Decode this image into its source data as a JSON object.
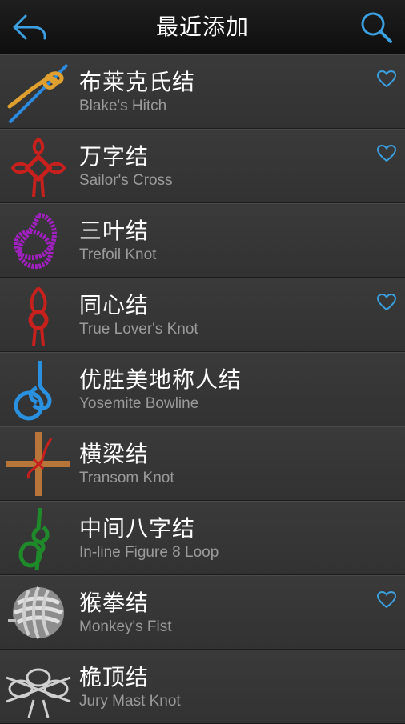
{
  "header": {
    "title": "最近添加",
    "back_icon": "back-arrow-icon",
    "search_icon": "search-icon",
    "accent_color": "#3aa0e0"
  },
  "knots": [
    {
      "name_zh": "布莱克氏结",
      "name_en": "Blake's Hitch",
      "favorite": true,
      "color": "#e0a030"
    },
    {
      "name_zh": "万字结",
      "name_en": "Sailor's Cross",
      "favorite": true,
      "color": "#c8201c"
    },
    {
      "name_zh": "三叶结",
      "name_en": "Trefoil Knot",
      "favorite": false,
      "color": "#a020c0"
    },
    {
      "name_zh": "同心结",
      "name_en": "True Lover's Knot",
      "favorite": true,
      "color": "#c8201c"
    },
    {
      "name_zh": "优胜美地称人结",
      "name_en": "Yosemite Bowline",
      "favorite": false,
      "color": "#2a90e0"
    },
    {
      "name_zh": "横梁结",
      "name_en": "Transom Knot",
      "favorite": false,
      "color": "#c8201c"
    },
    {
      "name_zh": "中间八字结",
      "name_en": "In-line Figure 8 Loop",
      "favorite": false,
      "color": "#1e8a2a"
    },
    {
      "name_zh": "猴拳结",
      "name_en": "Monkey's Fist",
      "favorite": true,
      "color": "#bdbdbd"
    },
    {
      "name_zh": "桅顶结",
      "name_en": "Jury Mast Knot",
      "favorite": false,
      "color": "#cfcfcf"
    }
  ]
}
